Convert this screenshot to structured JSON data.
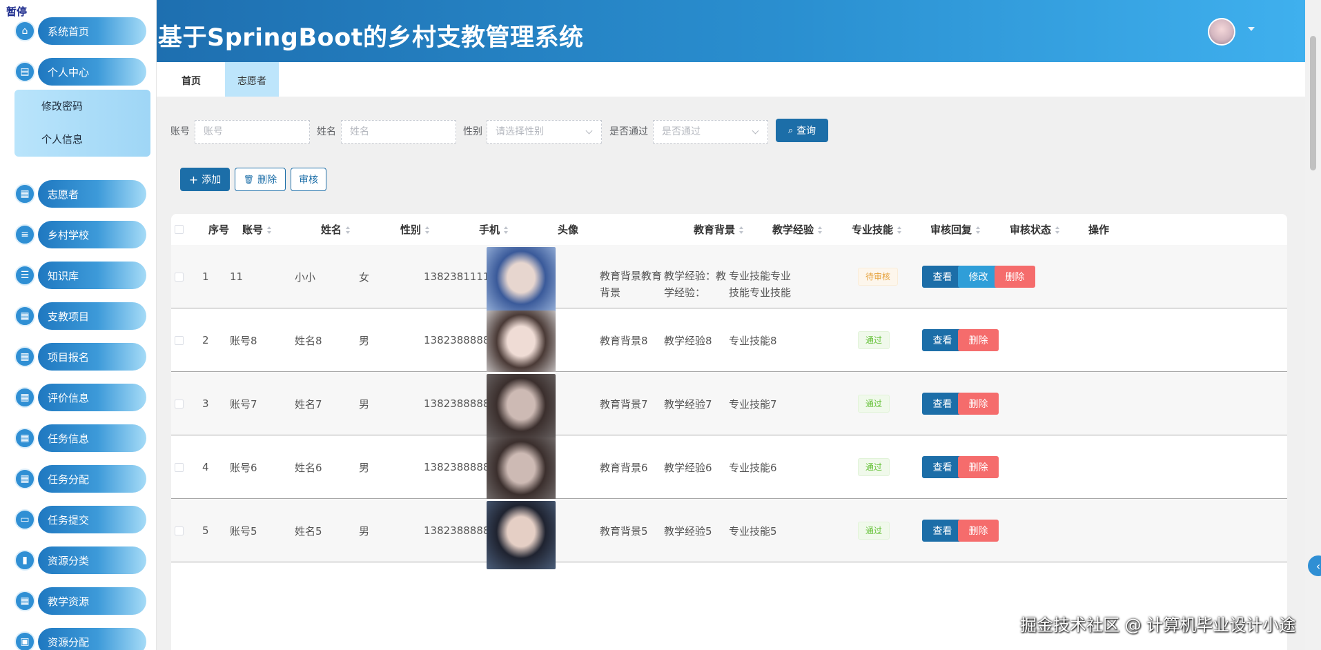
{
  "overlay": {
    "pause": "暂停",
    "watermark": "掘金技术社区 @ 计算机毕业设计小途"
  },
  "header": {
    "title": "基于SpringBoot的乡村支教管理系统"
  },
  "sidebar": {
    "items": [
      {
        "label": "系统首页",
        "icon": "home-icon"
      },
      {
        "label": "个人中心",
        "icon": "user-card-icon"
      },
      {
        "label": "志愿者",
        "icon": "grid-icon"
      },
      {
        "label": "乡村学校",
        "icon": "sliders-icon"
      },
      {
        "label": "知识库",
        "icon": "list-icon"
      },
      {
        "label": "支教项目",
        "icon": "grid-icon"
      },
      {
        "label": "项目报名",
        "icon": "grid-icon"
      },
      {
        "label": "评价信息",
        "icon": "grid-icon"
      },
      {
        "label": "任务信息",
        "icon": "grid-icon"
      },
      {
        "label": "任务分配",
        "icon": "grid-icon"
      },
      {
        "label": "任务提交",
        "icon": "monitor-icon"
      },
      {
        "label": "资源分类",
        "icon": "bar-chart-icon"
      },
      {
        "label": "教学资源",
        "icon": "grid-icon"
      },
      {
        "label": "资源分配",
        "icon": "clipboard-icon"
      }
    ],
    "submenu": [
      "修改密码",
      "个人信息"
    ]
  },
  "tabs": [
    "首页",
    "志愿者"
  ],
  "search": {
    "account_label": "账号",
    "account_placeholder": "账号",
    "name_label": "姓名",
    "name_placeholder": "姓名",
    "gender_label": "性别",
    "gender_placeholder": "请选择性别",
    "pass_label": "是否通过",
    "pass_placeholder": "是否通过",
    "query_button": "查询"
  },
  "toolbar": {
    "add": "添加",
    "delete": "删除",
    "audit": "审核"
  },
  "table": {
    "headers": [
      "序号",
      "账号",
      "姓名",
      "性别",
      "手机",
      "头像",
      "教育背景",
      "教学经验",
      "专业技能",
      "审核回复",
      "审核状态",
      "操作"
    ],
    "actions": {
      "view": "查看",
      "edit": "修改",
      "delete": "删除"
    },
    "rows": [
      {
        "no": "1",
        "account": "11",
        "name": "小小",
        "gender": "女",
        "phone": "13823811111",
        "edu": "教育背景教育背景",
        "exp": "教学经验：教学经验：",
        "skill": "专业技能专业技能专业技能",
        "reply": "",
        "status": "待审核",
        "status_type": "warn",
        "photo": [
          "#3a5a9a",
          "#e7d6cf",
          "#9fb8de"
        ]
      },
      {
        "no": "2",
        "account": "账号8",
        "name": "姓名8",
        "gender": "男",
        "phone": "13823888888",
        "edu": "教育背景8",
        "exp": "教学经验8",
        "skill": "专业技能8",
        "reply": "",
        "status": "通过",
        "status_type": "ok",
        "photo": [
          "#4a3a36",
          "#efdcd5",
          "#d9d7d8"
        ]
      },
      {
        "no": "3",
        "account": "账号7",
        "name": "姓名7",
        "gender": "男",
        "phone": "13823888887",
        "edu": "教育背景7",
        "exp": "教学经验7",
        "skill": "专业技能7",
        "reply": "",
        "status": "通过",
        "status_type": "ok",
        "photo": [
          "#3b2f2d",
          "#cdbab4",
          "#6c6767"
        ]
      },
      {
        "no": "4",
        "account": "账号6",
        "name": "姓名6",
        "gender": "男",
        "phone": "13823888886",
        "edu": "教育背景6",
        "exp": "教学经验6",
        "skill": "专业技能6",
        "reply": "",
        "status": "通过",
        "status_type": "ok",
        "photo": [
          "#3b2f2d",
          "#cdbab4",
          "#7a7575"
        ]
      },
      {
        "no": "5",
        "account": "账号5",
        "name": "姓名5",
        "gender": "男",
        "phone": "13823888885",
        "edu": "教育背景5",
        "exp": "教学经验5",
        "skill": "专业技能5",
        "reply": "",
        "status": "通过",
        "status_type": "ok",
        "photo": [
          "#1f2330",
          "#e5cfc5",
          "#4b5e7a"
        ]
      }
    ]
  },
  "colors": {
    "primary": "#1c6ea8",
    "danger": "#f56c6c",
    "edit": "#2f9ed8",
    "header": "#2a8fd0"
  }
}
